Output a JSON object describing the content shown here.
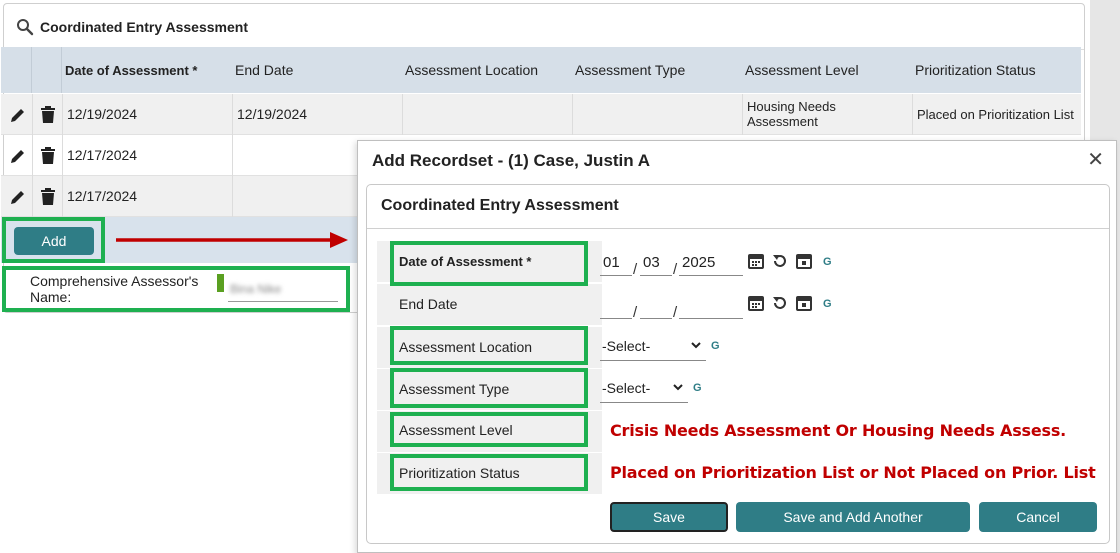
{
  "background": {
    "panel_title": "Coordinated Entry Assessment",
    "columns": [
      "Date of Assessment *",
      "End Date",
      "Assessment Location",
      "Assessment Type",
      "Assessment Level",
      "Prioritization Status"
    ],
    "rows": [
      {
        "date": "12/19/2024",
        "end_date": "12/19/2024",
        "location": "",
        "type": "",
        "level": "Housing Needs Assessment",
        "status": "Placed on Prioritization List"
      },
      {
        "date": "12/17/2024",
        "end_date": "",
        "location": "",
        "type": "",
        "level": "",
        "status": ""
      },
      {
        "date": "12/17/2024",
        "end_date": "",
        "location": "",
        "type": "",
        "level": "",
        "status": ""
      }
    ],
    "add_label": "Add",
    "assessor_label": "Comprehensive Assessor's Name:",
    "assessor_value": "Bina Nike"
  },
  "modal": {
    "title": "Add Recordset - (1) Case, Justin A",
    "close_symbol": "✕",
    "section_title": "Coordinated Entry Assessment",
    "fields": {
      "date_of_assessment": {
        "label": "Date of Assessment *",
        "month": "01",
        "day": "03",
        "year": "2025"
      },
      "end_date": {
        "label": "End Date",
        "month": "",
        "day": "",
        "year": ""
      },
      "assessment_location": {
        "label": "Assessment Location",
        "value": "-Select-"
      },
      "assessment_type": {
        "label": "Assessment Type",
        "value": "-Select-"
      },
      "assessment_level": {
        "label": "Assessment Level"
      },
      "prioritization_status": {
        "label": "Prioritization Status"
      }
    },
    "g_label": "G",
    "slash": "/",
    "buttons": {
      "save": "Save",
      "save_add": "Save and Add Another",
      "cancel": "Cancel"
    }
  },
  "annotations": {
    "level_note": "Crisis Needs Assessment Or Housing Needs Assess.",
    "status_note": "Placed on Prioritization List or Not Placed on Prior. List"
  },
  "colors": {
    "highlight_green": "#1eb050",
    "arrow_red": "#c00000",
    "button_teal": "#2f7d86",
    "header_blue_gray": "#d6dfe8"
  }
}
